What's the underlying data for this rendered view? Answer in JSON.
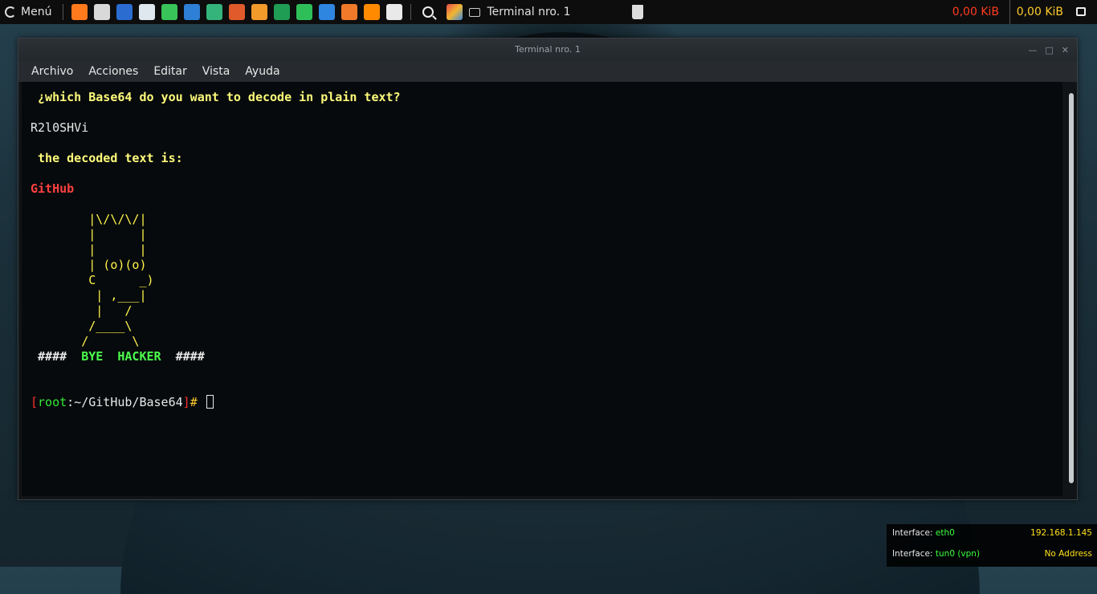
{
  "taskbar": {
    "menu_label": "Menú",
    "task_title": "Terminal nro. 1",
    "net_down": "0,00 KiB",
    "net_up": "0,00 KiB",
    "launchers": [
      {
        "icon": "firefox-icon",
        "color": "#ff7a1c"
      },
      {
        "icon": "terminal-icon",
        "color": "#d9d9d9"
      },
      {
        "icon": "metasploit-icon",
        "color": "#2b6cd0"
      },
      {
        "icon": "folder-icon",
        "color": "#dfe7ef"
      },
      {
        "icon": "speed-icon",
        "color": "#39c45a"
      },
      {
        "icon": "wireshark-icon",
        "color": "#2e7fd6"
      },
      {
        "icon": "kali-dragon-icon",
        "color": "#34b37a"
      },
      {
        "icon": "burpsuite-icon",
        "color": "#e05a2b"
      },
      {
        "icon": "sublime-icon",
        "color": "#f29a2a"
      },
      {
        "icon": "spreadsheet-icon",
        "color": "#1f9d55"
      },
      {
        "icon": "calc-icon",
        "color": "#2fbf59"
      },
      {
        "icon": "writer-icon",
        "color": "#2f86e0"
      },
      {
        "icon": "impress-icon",
        "color": "#f07a2a"
      },
      {
        "icon": "vlc-icon",
        "color": "#ff8a00"
      },
      {
        "icon": "camera-icon",
        "color": "#e9e9e9"
      }
    ]
  },
  "window": {
    "title": "Terminal nro. 1",
    "menu": [
      "Archivo",
      "Acciones",
      "Editar",
      "Vista",
      "Ayuda"
    ]
  },
  "terminal": {
    "prompt_question": " ¿which Base64 do you want to decode in plain text?",
    "input_value": "R2l0SHVi",
    "decoded_label": " the decoded text is:",
    "decoded_value": "GitHub",
    "ascii_art": [
      "        |\\/\\/\\/|",
      "        |      |",
      "        |      |",
      "        | (o)(o)",
      "        C      _)",
      "         | ,___|",
      "         |   /",
      "        /____\\",
      "       /      \\"
    ],
    "bye_hash_left": " #### ",
    "bye_word1": " BYE ",
    "bye_word2": " HACKER ",
    "bye_hash_right": " ####",
    "prompt_bracket_open": "[",
    "prompt_user": "root",
    "prompt_path": ":~/GitHub/Base64",
    "prompt_bracket_close": "]",
    "prompt_hash": "# "
  },
  "conky": {
    "iface1_label": "Interface:",
    "iface1_name": "eth0",
    "iface1_ip": "192.168.1.145",
    "iface2_label": "Interface:",
    "iface2_name": "tun0 (vpn)",
    "iface2_ip": "No Address"
  }
}
